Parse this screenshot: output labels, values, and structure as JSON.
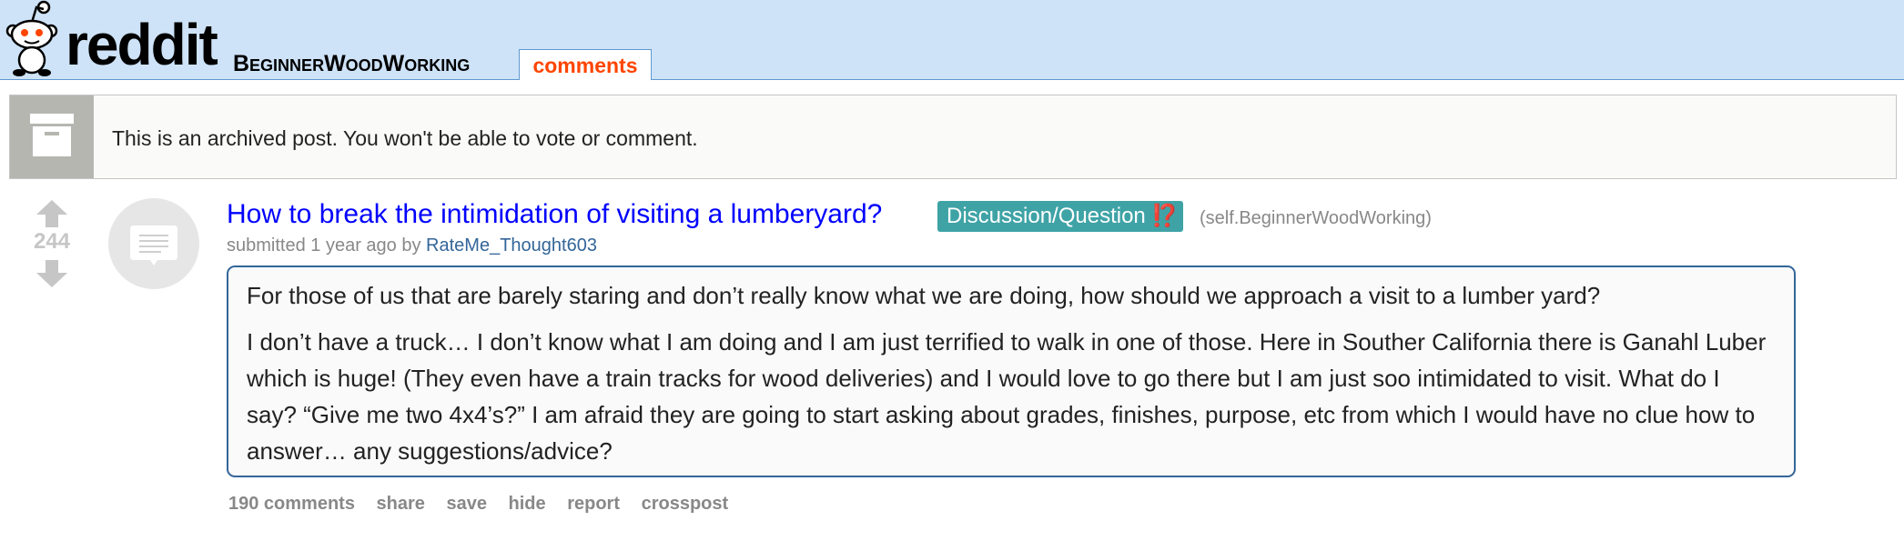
{
  "header": {
    "wordmark": "reddit",
    "subreddit": "BeginnerWoodWorking",
    "tab_comments": "comments"
  },
  "archived": {
    "text": "This is an archived post. You won't be able to vote or comment."
  },
  "post": {
    "score": "244",
    "title": "How to break the intimidation of visiting a lumberyard?",
    "flair": {
      "text": "Discussion/Question",
      "emoji": "⁉️"
    },
    "domain": "(self.BeginnerWoodWorking)",
    "tagline": {
      "prefix": "submitted",
      "time": "1 year ago",
      "by": "by",
      "author": "RateMe_Thought603"
    },
    "selftext": {
      "para1": "For those of us that are barely staring and don’t really know what we are doing, how should we approach a visit to a lumber yard?",
      "para2": "I don’t have a truck… I don’t know what I am doing and I am just terrified to walk in one of those. Here in Souther California there is Ganahl Luber which is huge! (They even have a train tracks for wood deliveries) and I would love to go there but I am just soo intimidated to visit. What do I say? “Give me two 4x4’s?” I am afraid they are going to start asking about grades, finishes, purpose, etc from which I would have no clue how to answer… any suggestions/advice?"
    },
    "buttons": {
      "comments": "190 comments",
      "share": "share",
      "save": "save",
      "hide": "hide",
      "report": "report",
      "crosspost": "crosspost"
    }
  },
  "colors": {
    "header_bg": "#cee3f8",
    "title_link": "#0000ff",
    "flair_bg": "#3fa3a6",
    "active_tab": "#ff4500",
    "author_link": "#336699"
  },
  "icons": {
    "logo": "reddit-alien-icon",
    "archive": "archive-box-icon",
    "upvote": "upvote-arrow-icon",
    "downvote": "downvote-arrow-icon",
    "thumbnail": "self-post-icon"
  }
}
